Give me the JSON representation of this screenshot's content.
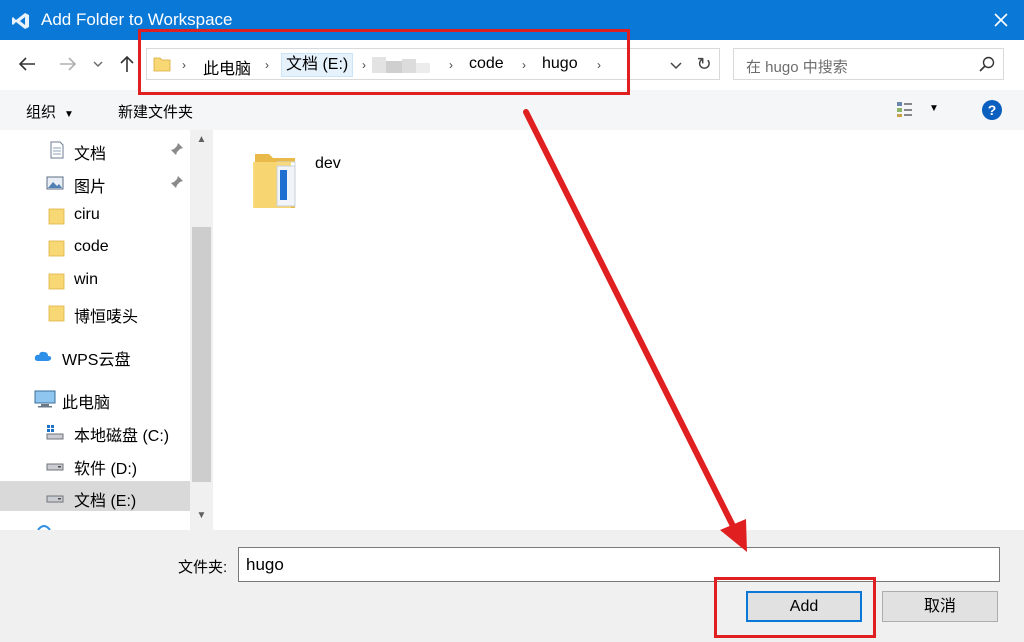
{
  "window": {
    "title": "Add Folder to Workspace",
    "close": "✕"
  },
  "address": {
    "crumbs": [
      "此电脑",
      "文档 (E:)",
      "code",
      "hugo"
    ],
    "refresh": "↻"
  },
  "search": {
    "placeholder": "在 hugo 中搜索"
  },
  "toolbar": {
    "organize": "组织",
    "new_folder": "新建文件夹",
    "help": "?"
  },
  "sidebar": {
    "items": [
      {
        "label": "文档",
        "icon": "document-icon",
        "pinned": true
      },
      {
        "label": "图片",
        "icon": "pictures-icon",
        "pinned": true
      },
      {
        "label": "ciru",
        "icon": "folder-icon"
      },
      {
        "label": "code",
        "icon": "folder-icon"
      },
      {
        "label": "win",
        "icon": "folder-icon"
      },
      {
        "label": "博恒唛头",
        "icon": "folder-icon"
      },
      {
        "label": "WPS云盘",
        "icon": "cloud-icon"
      },
      {
        "label": "此电脑",
        "icon": "computer-icon"
      },
      {
        "label": "本地磁盘 (C:)",
        "icon": "drive-icon"
      },
      {
        "label": "软件 (D:)",
        "icon": "drive-icon"
      },
      {
        "label": "文档 (E:)",
        "icon": "drive-icon",
        "selected": true
      }
    ]
  },
  "files": [
    {
      "name": "dev",
      "icon": "folder-icon"
    }
  ],
  "footer": {
    "folder_label": "文件夹:",
    "folder_value": "hugo",
    "add_button": "Add",
    "cancel_button": "取消"
  },
  "colors": {
    "titlebar": "#0a78d7",
    "annotation": "#e02020"
  }
}
